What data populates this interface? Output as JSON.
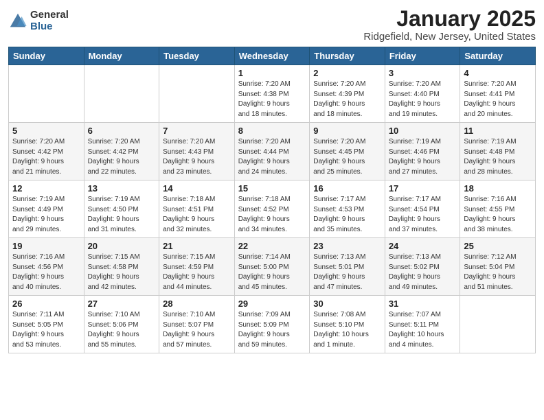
{
  "header": {
    "logo_general": "General",
    "logo_blue": "Blue",
    "month": "January 2025",
    "location": "Ridgefield, New Jersey, United States"
  },
  "weekdays": [
    "Sunday",
    "Monday",
    "Tuesday",
    "Wednesday",
    "Thursday",
    "Friday",
    "Saturday"
  ],
  "weeks": [
    [
      {
        "day": "",
        "info": ""
      },
      {
        "day": "",
        "info": ""
      },
      {
        "day": "",
        "info": ""
      },
      {
        "day": "1",
        "info": "Sunrise: 7:20 AM\nSunset: 4:38 PM\nDaylight: 9 hours\nand 18 minutes."
      },
      {
        "day": "2",
        "info": "Sunrise: 7:20 AM\nSunset: 4:39 PM\nDaylight: 9 hours\nand 18 minutes."
      },
      {
        "day": "3",
        "info": "Sunrise: 7:20 AM\nSunset: 4:40 PM\nDaylight: 9 hours\nand 19 minutes."
      },
      {
        "day": "4",
        "info": "Sunrise: 7:20 AM\nSunset: 4:41 PM\nDaylight: 9 hours\nand 20 minutes."
      }
    ],
    [
      {
        "day": "5",
        "info": "Sunrise: 7:20 AM\nSunset: 4:42 PM\nDaylight: 9 hours\nand 21 minutes."
      },
      {
        "day": "6",
        "info": "Sunrise: 7:20 AM\nSunset: 4:42 PM\nDaylight: 9 hours\nand 22 minutes."
      },
      {
        "day": "7",
        "info": "Sunrise: 7:20 AM\nSunset: 4:43 PM\nDaylight: 9 hours\nand 23 minutes."
      },
      {
        "day": "8",
        "info": "Sunrise: 7:20 AM\nSunset: 4:44 PM\nDaylight: 9 hours\nand 24 minutes."
      },
      {
        "day": "9",
        "info": "Sunrise: 7:20 AM\nSunset: 4:45 PM\nDaylight: 9 hours\nand 25 minutes."
      },
      {
        "day": "10",
        "info": "Sunrise: 7:19 AM\nSunset: 4:46 PM\nDaylight: 9 hours\nand 27 minutes."
      },
      {
        "day": "11",
        "info": "Sunrise: 7:19 AM\nSunset: 4:48 PM\nDaylight: 9 hours\nand 28 minutes."
      }
    ],
    [
      {
        "day": "12",
        "info": "Sunrise: 7:19 AM\nSunset: 4:49 PM\nDaylight: 9 hours\nand 29 minutes."
      },
      {
        "day": "13",
        "info": "Sunrise: 7:19 AM\nSunset: 4:50 PM\nDaylight: 9 hours\nand 31 minutes."
      },
      {
        "day": "14",
        "info": "Sunrise: 7:18 AM\nSunset: 4:51 PM\nDaylight: 9 hours\nand 32 minutes."
      },
      {
        "day": "15",
        "info": "Sunrise: 7:18 AM\nSunset: 4:52 PM\nDaylight: 9 hours\nand 34 minutes."
      },
      {
        "day": "16",
        "info": "Sunrise: 7:17 AM\nSunset: 4:53 PM\nDaylight: 9 hours\nand 35 minutes."
      },
      {
        "day": "17",
        "info": "Sunrise: 7:17 AM\nSunset: 4:54 PM\nDaylight: 9 hours\nand 37 minutes."
      },
      {
        "day": "18",
        "info": "Sunrise: 7:16 AM\nSunset: 4:55 PM\nDaylight: 9 hours\nand 38 minutes."
      }
    ],
    [
      {
        "day": "19",
        "info": "Sunrise: 7:16 AM\nSunset: 4:56 PM\nDaylight: 9 hours\nand 40 minutes."
      },
      {
        "day": "20",
        "info": "Sunrise: 7:15 AM\nSunset: 4:58 PM\nDaylight: 9 hours\nand 42 minutes."
      },
      {
        "day": "21",
        "info": "Sunrise: 7:15 AM\nSunset: 4:59 PM\nDaylight: 9 hours\nand 44 minutes."
      },
      {
        "day": "22",
        "info": "Sunrise: 7:14 AM\nSunset: 5:00 PM\nDaylight: 9 hours\nand 45 minutes."
      },
      {
        "day": "23",
        "info": "Sunrise: 7:13 AM\nSunset: 5:01 PM\nDaylight: 9 hours\nand 47 minutes."
      },
      {
        "day": "24",
        "info": "Sunrise: 7:13 AM\nSunset: 5:02 PM\nDaylight: 9 hours\nand 49 minutes."
      },
      {
        "day": "25",
        "info": "Sunrise: 7:12 AM\nSunset: 5:04 PM\nDaylight: 9 hours\nand 51 minutes."
      }
    ],
    [
      {
        "day": "26",
        "info": "Sunrise: 7:11 AM\nSunset: 5:05 PM\nDaylight: 9 hours\nand 53 minutes."
      },
      {
        "day": "27",
        "info": "Sunrise: 7:10 AM\nSunset: 5:06 PM\nDaylight: 9 hours\nand 55 minutes."
      },
      {
        "day": "28",
        "info": "Sunrise: 7:10 AM\nSunset: 5:07 PM\nDaylight: 9 hours\nand 57 minutes."
      },
      {
        "day": "29",
        "info": "Sunrise: 7:09 AM\nSunset: 5:09 PM\nDaylight: 9 hours\nand 59 minutes."
      },
      {
        "day": "30",
        "info": "Sunrise: 7:08 AM\nSunset: 5:10 PM\nDaylight: 10 hours\nand 1 minute."
      },
      {
        "day": "31",
        "info": "Sunrise: 7:07 AM\nSunset: 5:11 PM\nDaylight: 10 hours\nand 4 minutes."
      },
      {
        "day": "",
        "info": ""
      }
    ]
  ]
}
